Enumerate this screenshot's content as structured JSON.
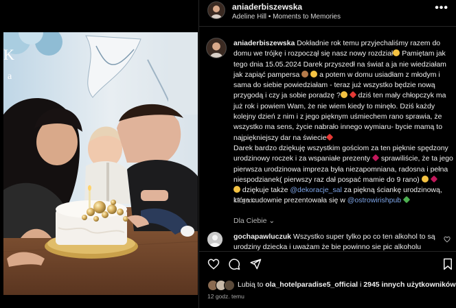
{
  "photo": {
    "letter_left": "K",
    "letter_small": "a"
  },
  "header": {
    "username": "aniaderbiszewska",
    "subtitle": "Adeline Hill • Moments to Memories",
    "more": "•••"
  },
  "caption": {
    "username": "aniaderbiszewska",
    "p1": " Dokładnie rok temu przyjechaliśmy razem do domu we trójkę i rozpoczął się nasz nowy rozdział",
    "p2": " Pamiętam jak tego dnia 15.05.2024 Darek przyszedł na świat a ja nie wiedziałam jak zapiąć pampersa",
    "p3": " a potem w domu usiadłam z młodym i sama do siebie powiedziałam - teraz już wszystko będzie nową przygodą i czy ja sobie poradzę ?",
    "p4": " dziś ten mały chłopczyk ma już rok i powiem Wam, że nie wiem kiedy to minęło. Dziś każdy kolejny dzień z nim i z jego pięknym uśmiechem rano sprawia, że wszystko ma sens, życie nabrało innego wymiaru- bycie mamą to najpiękniejszy dar na świecie",
    "p5": "Darek bardzo dziękuję wszystkim gościom za ten pięknie spędzony urodzinowy roczek i za wspaniałe prezenty",
    "p6": " sprawiliście, że ta jego pierwsza urodzinowa impreza była niezapomniana, radosna i pełna niespodzianek( pierwszy raz dał pospać mamie do 9 rano)",
    "p7": " dziękuje także ",
    "mention1": "@dekoracje_sal",
    "p8": " za piękną ściankę urodzinową, która cudownie prezentowała się w ",
    "mention2": "@ostrowirishpub",
    "time": "12 godz."
  },
  "language": "Dla Ciebie ⌄",
  "comment": {
    "username": "gochapawluczuk",
    "text": " Wszystko super tylko po co ten alkohol to są urodziny dziecka i uważam że bie powinno sie pic alkoholu"
  },
  "likes": {
    "prefix": "Lubią to ",
    "user": "ola_hotelparadise5_official",
    "middle": " i ",
    "count": "2945 innych użytkowników"
  },
  "date": "12 godz. temu",
  "icons": {
    "like": "heart-icon",
    "comment": "comment-icon",
    "share": "share-icon",
    "save": "bookmark-icon"
  },
  "colors": {
    "background": "#000000",
    "link": "#7fa6e8",
    "muted": "#a8a8a8"
  }
}
